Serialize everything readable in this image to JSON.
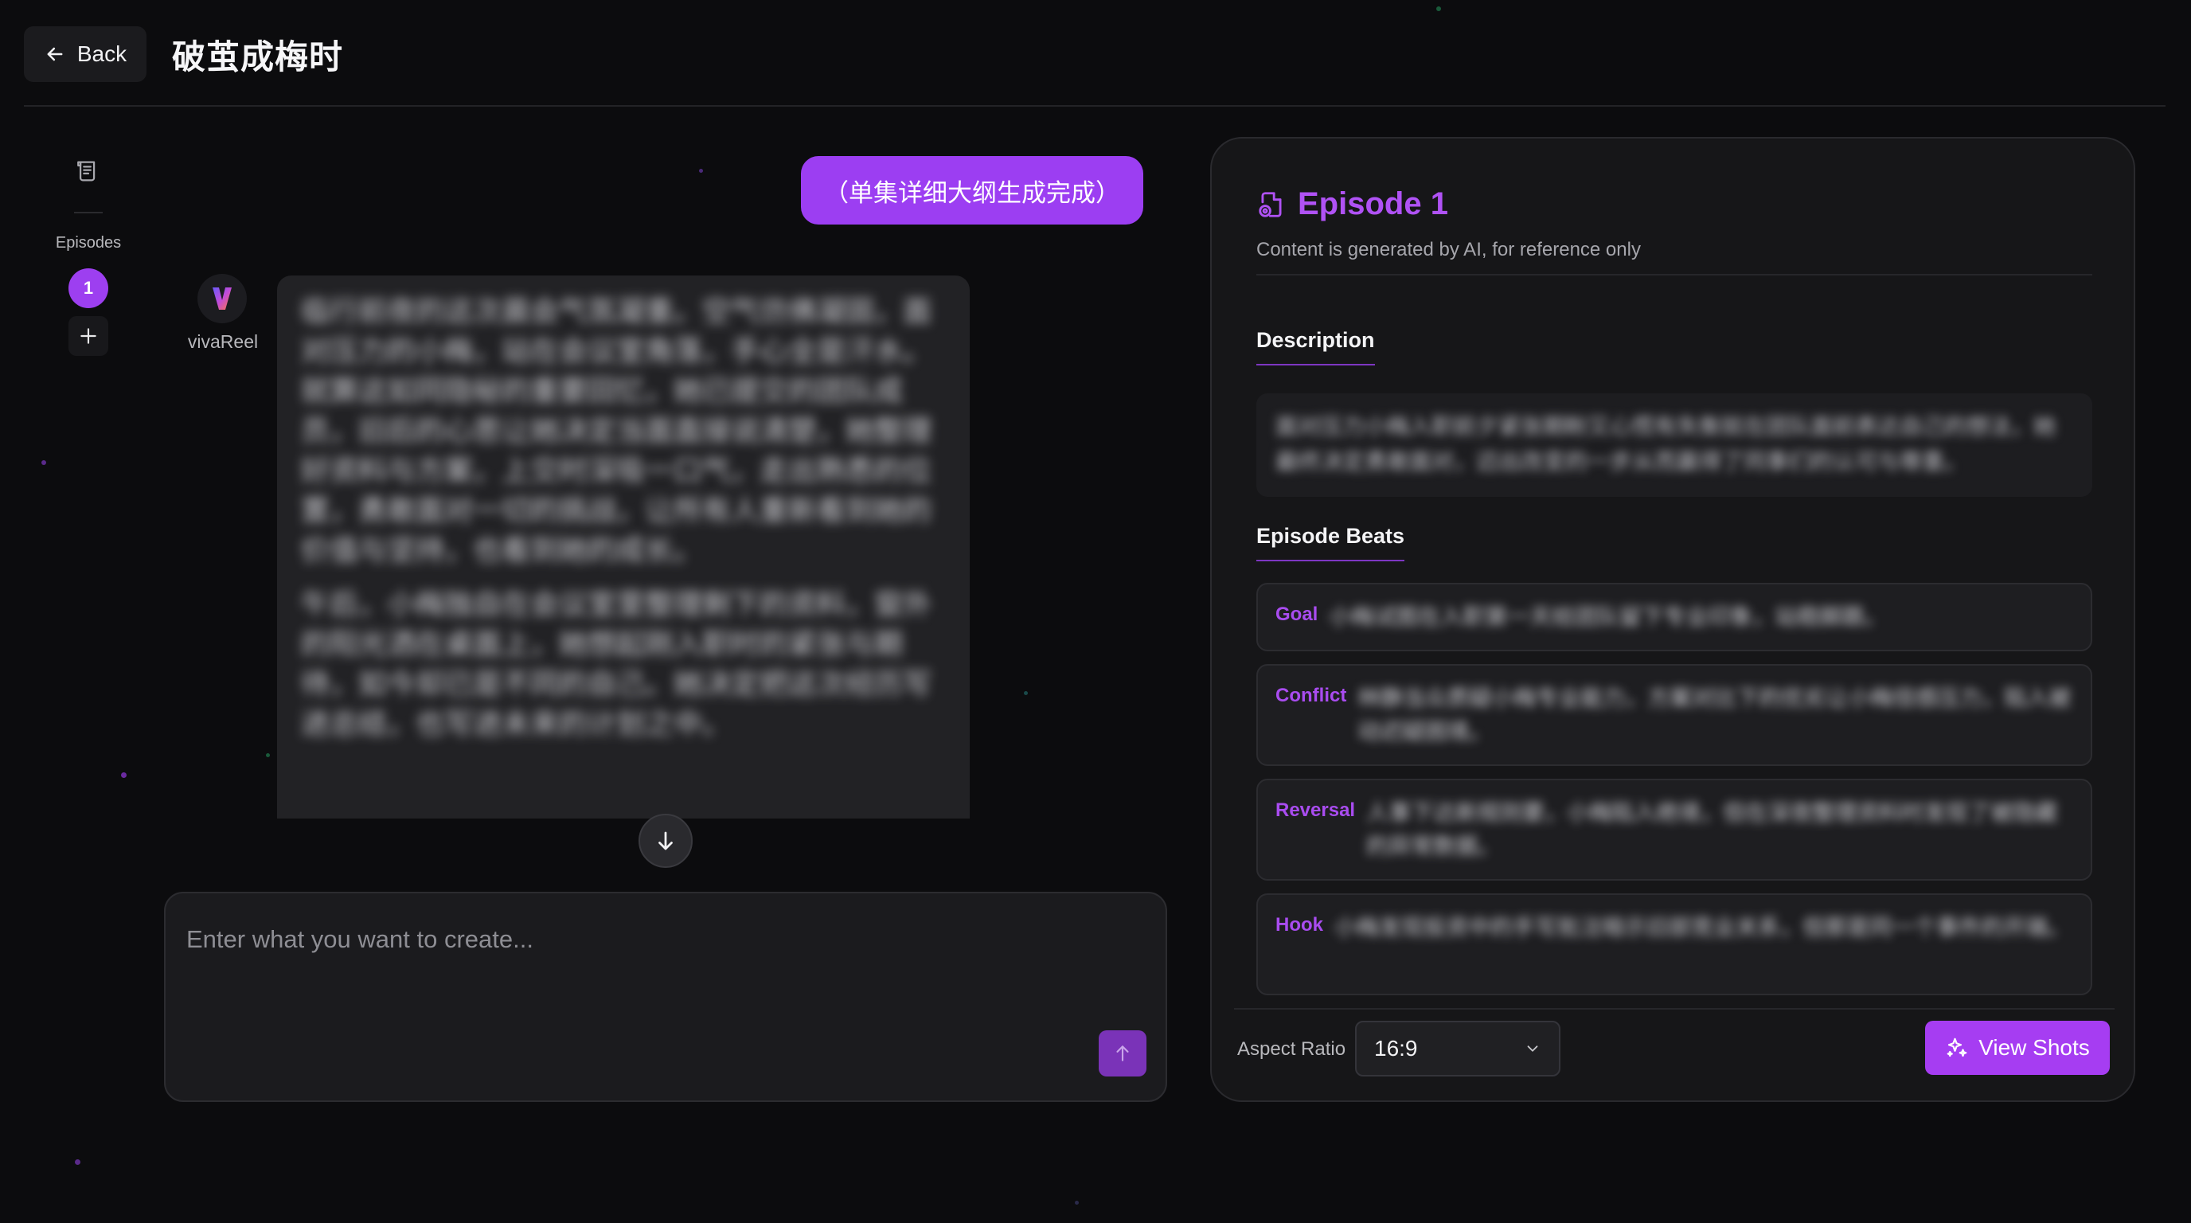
{
  "header": {
    "back_label": "Back",
    "title": "破茧成梅时"
  },
  "rail": {
    "episodes_label": "Episodes",
    "episode_numbers": [
      "1"
    ],
    "add_label": "+"
  },
  "chat": {
    "user_message": "（单集详细大纲生成完成）",
    "bot_name": "vivaReel",
    "bot_paragraphs": [
      "临行前夜的这次晨会气氛凝重。空气仿佛凝固，面对压力的小梅，站在会议室角落，手心全是汗水。就算这如同隐秘的重要回忆，她已提交的团队成员，旧后的心思让她决定当面直接说清楚，她整理好资料与方案，上交时深吸一口气，走出熟悉的位置，勇敢面对一切的挑战，让所有人重新看到她的价值与坚持，也看到她的成长。",
      "午后，小梅独自在会议室里整理剩下的资料，窗外的阳光洒在桌面上，她想起刚入职时的紧张与期待，如今却已是不同的自己。她决定把这次经历写进总结，也写进未来的计划之中。"
    ],
    "composer_placeholder": "Enter what you want to create..."
  },
  "panel": {
    "episode_title": "Episode 1",
    "subtitle": "Content is generated by AI, for reference only",
    "description_title": "Description",
    "description_text": "面对压力小梅入职前夕紧张期盼又心慌有失衡就在团队面前表达自己的想法，她最终决定勇敢面对，迈出改变的一步从而赢得了同事们的认可与尊重。",
    "beats_title": "Episode Beats",
    "beats": [
      {
        "label": "Goal",
        "text": "小梅试图在入职第一天给团队留下专业印象，站稳脚跟。"
      },
      {
        "label": "Conflict",
        "text": "林静当众质疑小梅专业能力，方案对比下的优劣让小梅倍感压力，陷入被动迟疑困境。"
      },
      {
        "label": "Reversal",
        "text": "人事下达新规则要，小梅陷入绝境，但在深夜整理资料时发现了被隐藏的异常数据。"
      },
      {
        "label": "Hook",
        "text": "小梅发现投资中的手写批注暗示旧部竞业关系，但那是同一个事件的开端。"
      }
    ],
    "aspect_ratio_label": "Aspect Ratio",
    "aspect_ratio_value": "16:9",
    "view_shots_label": "View Shots"
  },
  "colors": {
    "accent": "#a63df2",
    "background": "#0c0c0e",
    "panel": "#161618"
  }
}
